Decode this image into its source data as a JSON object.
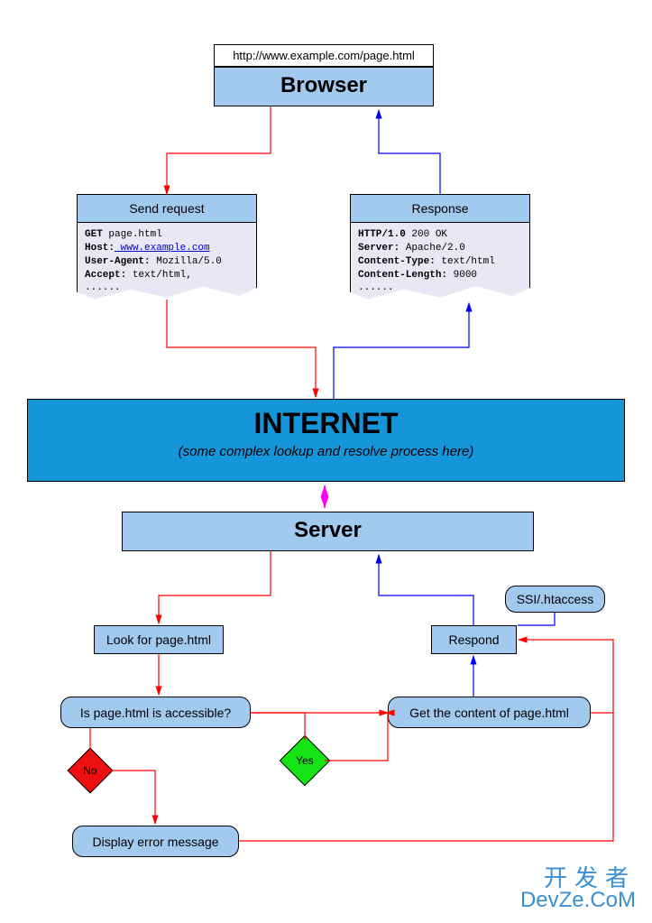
{
  "url_bar": "http://www.example.com/page.html",
  "browser_label": "Browser",
  "request": {
    "header": "Send request",
    "lines": [
      {
        "k": "GET",
        "v": " page.html",
        "link": false
      },
      {
        "k": "Host:",
        "v": " www.example.com",
        "link": true
      },
      {
        "k": "User-Agent:",
        "v": " Mozilla/5.0",
        "link": false
      },
      {
        "k": "Accept:",
        "v": " text/html,",
        "link": false
      }
    ],
    "dots": "......"
  },
  "response": {
    "header": "Response",
    "lines": [
      {
        "k": "HTTP/1.0",
        "v": " 200 OK",
        "link": false
      },
      {
        "k": "Server:",
        "v": " Apache/2.0",
        "link": false
      },
      {
        "k": "Content-Type:",
        "v": " text/html",
        "link": false
      },
      {
        "k": "Content-Length:",
        "v": " 9000",
        "link": false
      }
    ],
    "dots": "......"
  },
  "internet": {
    "title": "INTERNET",
    "subtitle": "(some complex lookup and resolve process here)"
  },
  "server_label": "Server",
  "nodes": {
    "ssi": "SSI/.htaccess",
    "look": "Look for page.html",
    "accessible": "Is page.html is accessible?",
    "respond": "Respond",
    "getcontent": "Get the content of page.html",
    "error": "Display error message"
  },
  "decisions": {
    "yes": "Yes",
    "no": "No"
  },
  "watermark": {
    "cn": "开发者",
    "en": "DevZe.CoM"
  },
  "colors": {
    "red": "#ff0000",
    "blue": "#0000ff",
    "magenta": "#ff00ff",
    "green": "#00dd00",
    "diamond_red": "#ee1010",
    "node_fill": "#a2c9ee",
    "doc_fill": "#e8e7f3",
    "internet_fill": "#1596db"
  }
}
